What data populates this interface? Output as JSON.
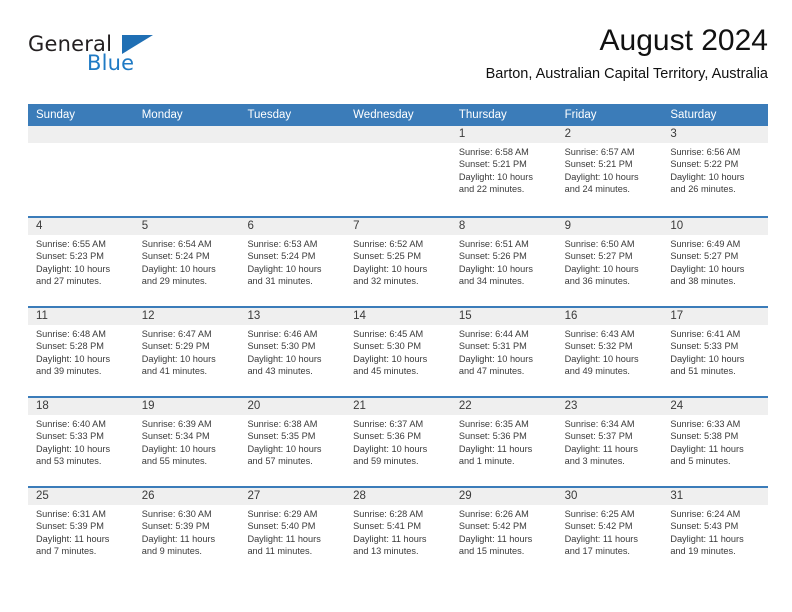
{
  "brand": {
    "name_top": "General",
    "name_bottom": "Blue",
    "triangle": "brand-triangle-icon",
    "colors": {
      "blue": "#1f7ac4",
      "dark": "#231f20"
    }
  },
  "header": {
    "month_title": "August 2024",
    "location": "Barton, Australian Capital Territory, Australia"
  },
  "theme": {
    "header_blue": "#3b7cb9",
    "daynum_band": "#efefef",
    "text": "#3a3a3a"
  },
  "calendar": {
    "weekdays": [
      "Sunday",
      "Monday",
      "Tuesday",
      "Wednesday",
      "Thursday",
      "Friday",
      "Saturday"
    ],
    "weeks": [
      [
        {
          "day": "",
          "lines": []
        },
        {
          "day": "",
          "lines": []
        },
        {
          "day": "",
          "lines": []
        },
        {
          "day": "",
          "lines": []
        },
        {
          "day": "1",
          "lines": [
            "Sunrise: 6:58 AM",
            "Sunset: 5:21 PM",
            "Daylight: 10 hours",
            "and 22 minutes."
          ]
        },
        {
          "day": "2",
          "lines": [
            "Sunrise: 6:57 AM",
            "Sunset: 5:21 PM",
            "Daylight: 10 hours",
            "and 24 minutes."
          ]
        },
        {
          "day": "3",
          "lines": [
            "Sunrise: 6:56 AM",
            "Sunset: 5:22 PM",
            "Daylight: 10 hours",
            "and 26 minutes."
          ]
        }
      ],
      [
        {
          "day": "4",
          "lines": [
            "Sunrise: 6:55 AM",
            "Sunset: 5:23 PM",
            "Daylight: 10 hours",
            "and 27 minutes."
          ]
        },
        {
          "day": "5",
          "lines": [
            "Sunrise: 6:54 AM",
            "Sunset: 5:24 PM",
            "Daylight: 10 hours",
            "and 29 minutes."
          ]
        },
        {
          "day": "6",
          "lines": [
            "Sunrise: 6:53 AM",
            "Sunset: 5:24 PM",
            "Daylight: 10 hours",
            "and 31 minutes."
          ]
        },
        {
          "day": "7",
          "lines": [
            "Sunrise: 6:52 AM",
            "Sunset: 5:25 PM",
            "Daylight: 10 hours",
            "and 32 minutes."
          ]
        },
        {
          "day": "8",
          "lines": [
            "Sunrise: 6:51 AM",
            "Sunset: 5:26 PM",
            "Daylight: 10 hours",
            "and 34 minutes."
          ]
        },
        {
          "day": "9",
          "lines": [
            "Sunrise: 6:50 AM",
            "Sunset: 5:27 PM",
            "Daylight: 10 hours",
            "and 36 minutes."
          ]
        },
        {
          "day": "10",
          "lines": [
            "Sunrise: 6:49 AM",
            "Sunset: 5:27 PM",
            "Daylight: 10 hours",
            "and 38 minutes."
          ]
        }
      ],
      [
        {
          "day": "11",
          "lines": [
            "Sunrise: 6:48 AM",
            "Sunset: 5:28 PM",
            "Daylight: 10 hours",
            "and 39 minutes."
          ]
        },
        {
          "day": "12",
          "lines": [
            "Sunrise: 6:47 AM",
            "Sunset: 5:29 PM",
            "Daylight: 10 hours",
            "and 41 minutes."
          ]
        },
        {
          "day": "13",
          "lines": [
            "Sunrise: 6:46 AM",
            "Sunset: 5:30 PM",
            "Daylight: 10 hours",
            "and 43 minutes."
          ]
        },
        {
          "day": "14",
          "lines": [
            "Sunrise: 6:45 AM",
            "Sunset: 5:30 PM",
            "Daylight: 10 hours",
            "and 45 minutes."
          ]
        },
        {
          "day": "15",
          "lines": [
            "Sunrise: 6:44 AM",
            "Sunset: 5:31 PM",
            "Daylight: 10 hours",
            "and 47 minutes."
          ]
        },
        {
          "day": "16",
          "lines": [
            "Sunrise: 6:43 AM",
            "Sunset: 5:32 PM",
            "Daylight: 10 hours",
            "and 49 minutes."
          ]
        },
        {
          "day": "17",
          "lines": [
            "Sunrise: 6:41 AM",
            "Sunset: 5:33 PM",
            "Daylight: 10 hours",
            "and 51 minutes."
          ]
        }
      ],
      [
        {
          "day": "18",
          "lines": [
            "Sunrise: 6:40 AM",
            "Sunset: 5:33 PM",
            "Daylight: 10 hours",
            "and 53 minutes."
          ]
        },
        {
          "day": "19",
          "lines": [
            "Sunrise: 6:39 AM",
            "Sunset: 5:34 PM",
            "Daylight: 10 hours",
            "and 55 minutes."
          ]
        },
        {
          "day": "20",
          "lines": [
            "Sunrise: 6:38 AM",
            "Sunset: 5:35 PM",
            "Daylight: 10 hours",
            "and 57 minutes."
          ]
        },
        {
          "day": "21",
          "lines": [
            "Sunrise: 6:37 AM",
            "Sunset: 5:36 PM",
            "Daylight: 10 hours",
            "and 59 minutes."
          ]
        },
        {
          "day": "22",
          "lines": [
            "Sunrise: 6:35 AM",
            "Sunset: 5:36 PM",
            "Daylight: 11 hours",
            "and 1 minute."
          ]
        },
        {
          "day": "23",
          "lines": [
            "Sunrise: 6:34 AM",
            "Sunset: 5:37 PM",
            "Daylight: 11 hours",
            "and 3 minutes."
          ]
        },
        {
          "day": "24",
          "lines": [
            "Sunrise: 6:33 AM",
            "Sunset: 5:38 PM",
            "Daylight: 11 hours",
            "and 5 minutes."
          ]
        }
      ],
      [
        {
          "day": "25",
          "lines": [
            "Sunrise: 6:31 AM",
            "Sunset: 5:39 PM",
            "Daylight: 11 hours",
            "and 7 minutes."
          ]
        },
        {
          "day": "26",
          "lines": [
            "Sunrise: 6:30 AM",
            "Sunset: 5:39 PM",
            "Daylight: 11 hours",
            "and 9 minutes."
          ]
        },
        {
          "day": "27",
          "lines": [
            "Sunrise: 6:29 AM",
            "Sunset: 5:40 PM",
            "Daylight: 11 hours",
            "and 11 minutes."
          ]
        },
        {
          "day": "28",
          "lines": [
            "Sunrise: 6:28 AM",
            "Sunset: 5:41 PM",
            "Daylight: 11 hours",
            "and 13 minutes."
          ]
        },
        {
          "day": "29",
          "lines": [
            "Sunrise: 6:26 AM",
            "Sunset: 5:42 PM",
            "Daylight: 11 hours",
            "and 15 minutes."
          ]
        },
        {
          "day": "30",
          "lines": [
            "Sunrise: 6:25 AM",
            "Sunset: 5:42 PM",
            "Daylight: 11 hours",
            "and 17 minutes."
          ]
        },
        {
          "day": "31",
          "lines": [
            "Sunrise: 6:24 AM",
            "Sunset: 5:43 PM",
            "Daylight: 11 hours",
            "and 19 minutes."
          ]
        }
      ]
    ]
  }
}
